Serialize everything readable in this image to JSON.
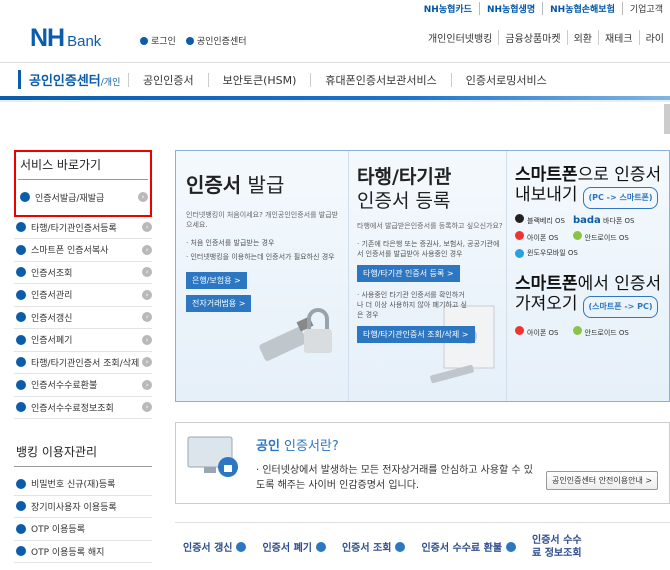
{
  "util_links": [
    "NH농협카드",
    "NH농협생명",
    "NH농협손해보험",
    "기업고객"
  ],
  "logo": {
    "nh": "NH",
    "bank": "Bank"
  },
  "top_links": [
    "로그인",
    "공인인증센터"
  ],
  "top_menu": [
    "개인인터넷뱅킹",
    "금융상품마켓",
    "외환",
    "재테크",
    "라이"
  ],
  "gnb": {
    "brand": "공인인증센터",
    "brand_sub": "/개인",
    "items": [
      "공인인증서",
      "보안토큰(HSM)",
      "휴대폰인증서보관서비스",
      "인증서로밍서비스"
    ]
  },
  "sidebar": {
    "service_title": "서비스 바로가기",
    "service_items": [
      "인증서발급/재발급",
      "타행/타기관인증서등록",
      "스마트폰 인증서복사",
      "인증서조회",
      "인증서관리",
      "인증서갱신",
      "인증서폐기",
      "타행/타기관인증서 조회/삭제",
      "인증서수수료환불",
      "인증서수수료정보조회"
    ],
    "user_title": "뱅킹 이용자관리",
    "user_items": [
      "비밀번호 신규(재)등록",
      "장기미사용자 이용등록",
      "OTP 이용등록",
      "OTP 이용등록 해지"
    ]
  },
  "panel": {
    "col1": {
      "title_b": "인증서",
      "title_n": " 발급",
      "sub": "인터넷뱅킹이 처음이세요? 개인공인인증서를 발급받으세요.",
      "bullets": [
        "· 처음 인증서를 발급받는 경우",
        "· 인터넷뱅킹을 이용하는데 인증서가 필요하신 경우"
      ],
      "buttons": [
        "은행/보험용 >",
        "전자거래범용 >"
      ]
    },
    "col2": {
      "title_b": "타행/타기관",
      "title_n": "인증서 등록",
      "sub": "타행에서 발급받은인증서를 등록하고 싶으신가요?",
      "bullets": [
        "· 기존에 타은행 또는 증권사, 보험사, 공공기관에서 인증서를 발급받아 사용중인 경우",
        "· 사용중인 타기관 인증서를 확인하거나 더 이상 사용하지 않아 폐기하고 싶은 경우"
      ],
      "buttons": [
        "타행/타기관 인증서 등록 >",
        "타행/타기관인증서 조회/삭제 >"
      ]
    },
    "col3": {
      "title1_b": "스마트폰",
      "title1_n": "으로 인증서",
      "title1_l2": "내보내기",
      "pill1": "(PC -> 스마트폰)",
      "os1": [
        "블랙베리 OS",
        "바다폰 OS",
        "아이폰 OS",
        "안드로이드 OS",
        "윈도우모바일 OS"
      ],
      "os1_bada": "bada",
      "title2_b": "스마트폰",
      "title2_n": "에서 인증서",
      "title2_l2": "가져오기",
      "pill2": "(스마트폰 -> PC)",
      "os2": [
        "아이폰 OS",
        "안드로이드 OS"
      ]
    }
  },
  "banner": {
    "title_b": "공인",
    "title_n": " 인증서란?",
    "text": "· 인터넷상에서 발생하는 모든 전자상거래를 안심하고 사용할 수 있도록 해주는 사이버 인감증명서 입니다.",
    "button": "공인인증센터 안전이용안내 >"
  },
  "quick": [
    "인증서 갱신",
    "인증서 폐기",
    "인증서 조회",
    "인증서 수수료 환불",
    "인증서 수수료 정보조회"
  ],
  "colors": {
    "brand": "#0b5cab",
    "accent": "#2d77c2",
    "highlight_border": "#e00000"
  }
}
